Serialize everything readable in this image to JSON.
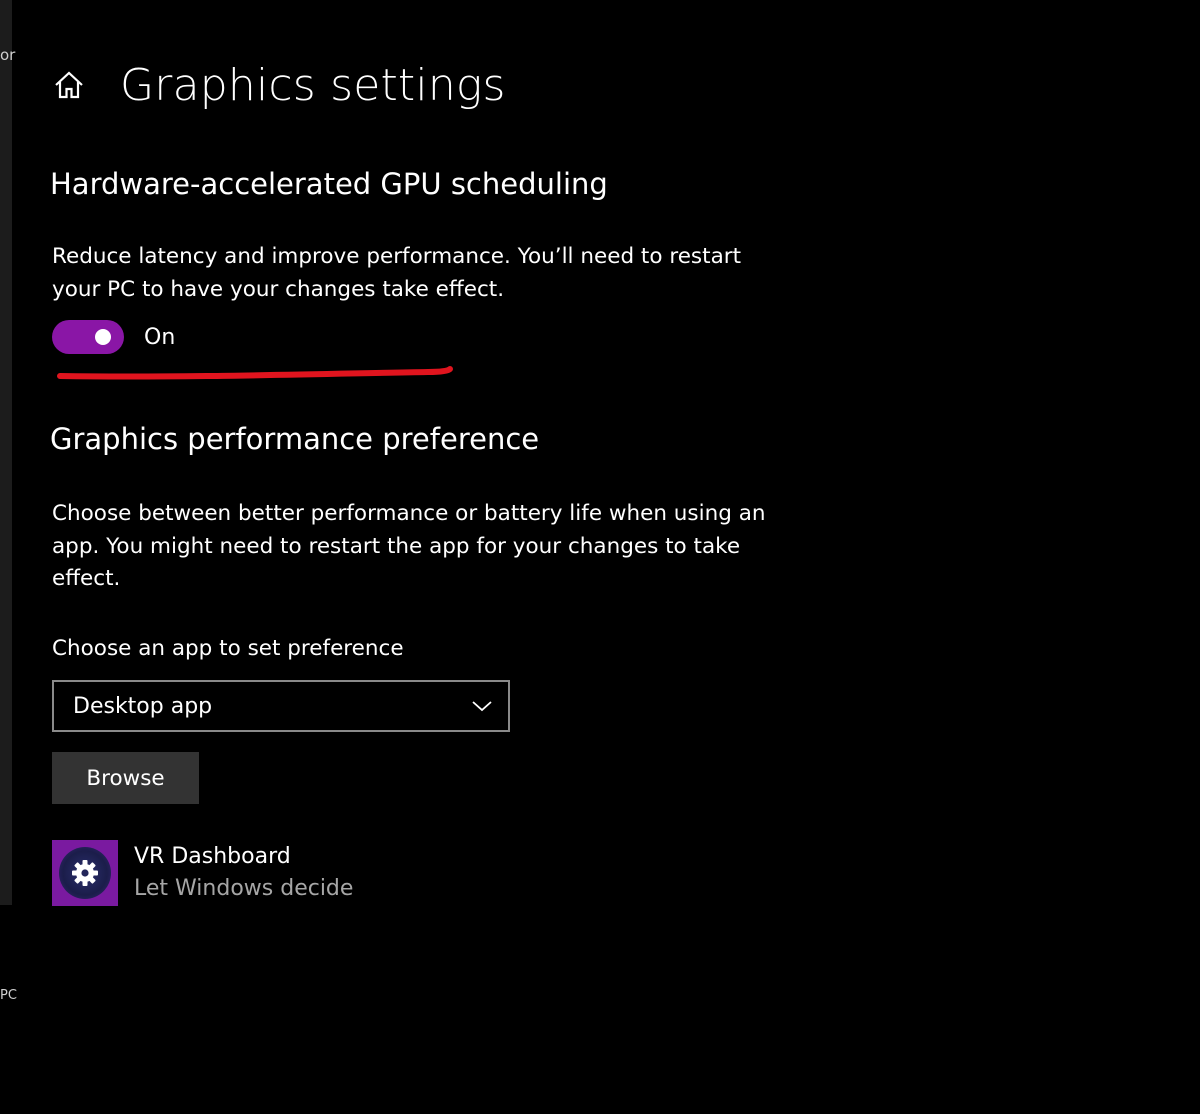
{
  "window": {
    "edge_text_top": "or",
    "edge_text_bottom": "PC"
  },
  "header": {
    "title": "Graphics settings",
    "home_icon": "home-icon"
  },
  "gpu_scheduling": {
    "title": "Hardware-accelerated GPU scheduling",
    "description": "Reduce latency and improve performance. You’ll need to restart your PC to have your changes take effect.",
    "toggle_state": "On",
    "toggle_color": "#8a16a6",
    "annotation_color": "#e0141e"
  },
  "performance_preference": {
    "title": "Graphics performance preference",
    "description": "Choose between better performance or battery life when using an app. You might need to restart the app for your changes to take effect.",
    "select_label": "Choose an app to set preference",
    "select_value": "Desktop app",
    "select_icon": "chevron-down-icon",
    "browse_label": "Browse"
  },
  "apps": [
    {
      "name": "VR Dashboard",
      "preference": "Let Windows decide",
      "icon": "gear-icon",
      "icon_color": "#7a1aa0"
    }
  ]
}
